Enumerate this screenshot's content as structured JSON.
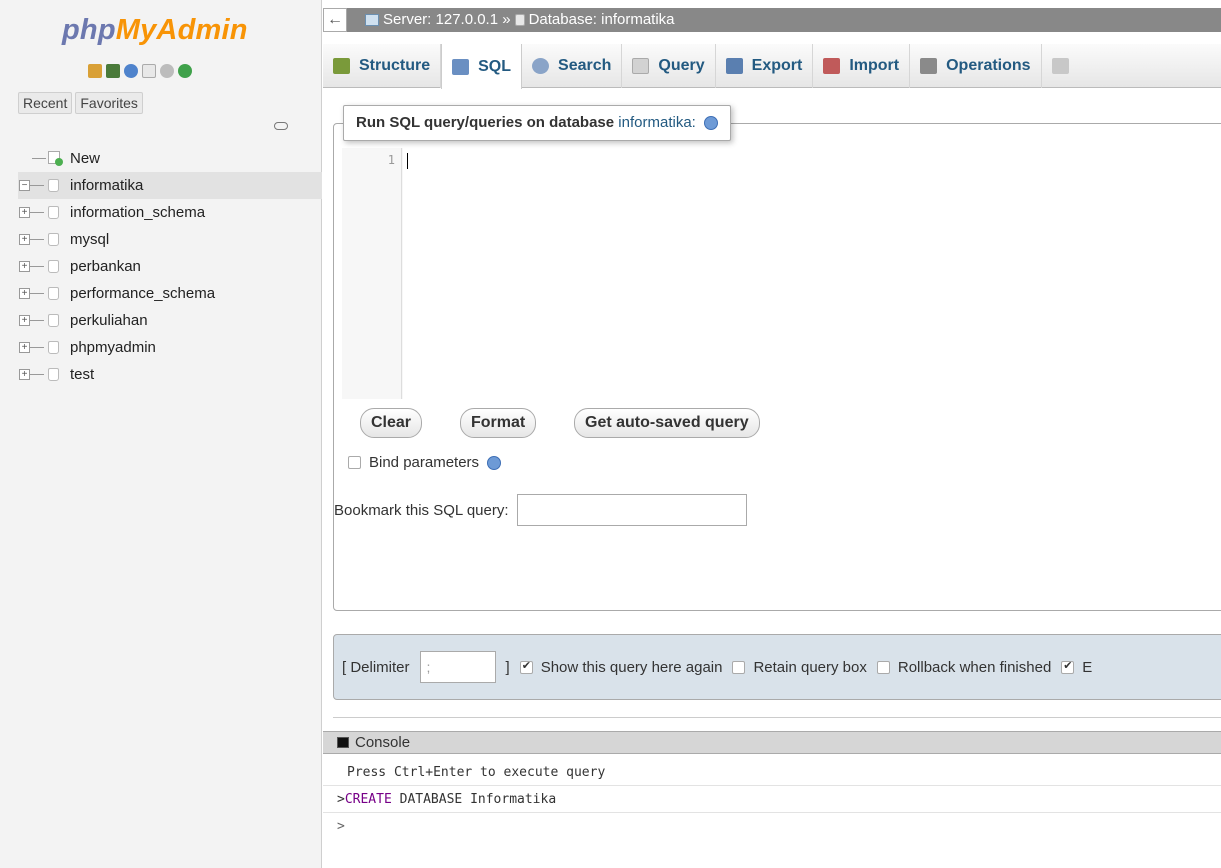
{
  "nav": {
    "logo_php": "php",
    "logo_myadmin": "MyAdmin",
    "icons": [
      "home-icon",
      "exit-icon",
      "help-icon",
      "docs-icon",
      "settings-icon",
      "reload-icon"
    ],
    "recent_label": "Recent",
    "favorites_label": "Favorites",
    "tree": [
      {
        "label": "New",
        "type": "new"
      },
      {
        "label": "informatika",
        "type": "db",
        "selected": true,
        "expander": "−"
      },
      {
        "label": "information_schema",
        "type": "db",
        "expander": "+"
      },
      {
        "label": "mysql",
        "type": "db",
        "expander": "+"
      },
      {
        "label": "perbankan",
        "type": "db",
        "expander": "+"
      },
      {
        "label": "performance_schema",
        "type": "db",
        "expander": "+"
      },
      {
        "label": "perkuliahan",
        "type": "db",
        "expander": "+"
      },
      {
        "label": "phpmyadmin",
        "type": "db",
        "expander": "+"
      },
      {
        "label": "test",
        "type": "db",
        "expander": "+"
      }
    ]
  },
  "topbar": {
    "back": "←",
    "server": "Server: 127.0.0.1 »",
    "database": "Database: informatika"
  },
  "tabs": [
    {
      "label": "Structure",
      "icon": "structure-icon",
      "color": "#7a9a3a"
    },
    {
      "label": "SQL",
      "icon": "sql-icon",
      "color": "#6a8fc2",
      "active": true
    },
    {
      "label": "Search",
      "icon": "search-icon",
      "color": "#8aa4c8"
    },
    {
      "label": "Query",
      "icon": "query-icon",
      "color": "#b7b7b7"
    },
    {
      "label": "Export",
      "icon": "export-icon",
      "color": "#5a7fb0"
    },
    {
      "label": "Import",
      "icon": "import-icon",
      "color": "#c05a5a"
    },
    {
      "label": "Operations",
      "icon": "operations-icon",
      "color": "#8a8a8a"
    },
    {
      "label": "",
      "icon": "more-icon",
      "color": "#b5b5b5"
    }
  ],
  "sql": {
    "legend_prefix": "Run SQL query/queries on database ",
    "legend_db": "informatika:",
    "line_number": "1",
    "clear": "Clear",
    "format": "Format",
    "autosave": "Get auto-saved query",
    "bind_parameters": "Bind parameters",
    "bookmark_label": "Bookmark this SQL query:"
  },
  "options": {
    "delimiter_label": "[ Delimiter",
    "delimiter_value": ";",
    "delimiter_close": "]",
    "show_query": "Show this query here again",
    "retain": "Retain query box",
    "rollback": "Rollback when finished",
    "last": "E"
  },
  "console": {
    "title": "Console",
    "message": "Press Ctrl+Enter to execute query",
    "prompt": ">",
    "query_keyword": "CREATE",
    "query_rest": " DATABASE Informatika"
  },
  "colors": {
    "link": "#235a81",
    "logo_orange": "#f89406",
    "logo_blue": "#6c78af"
  }
}
